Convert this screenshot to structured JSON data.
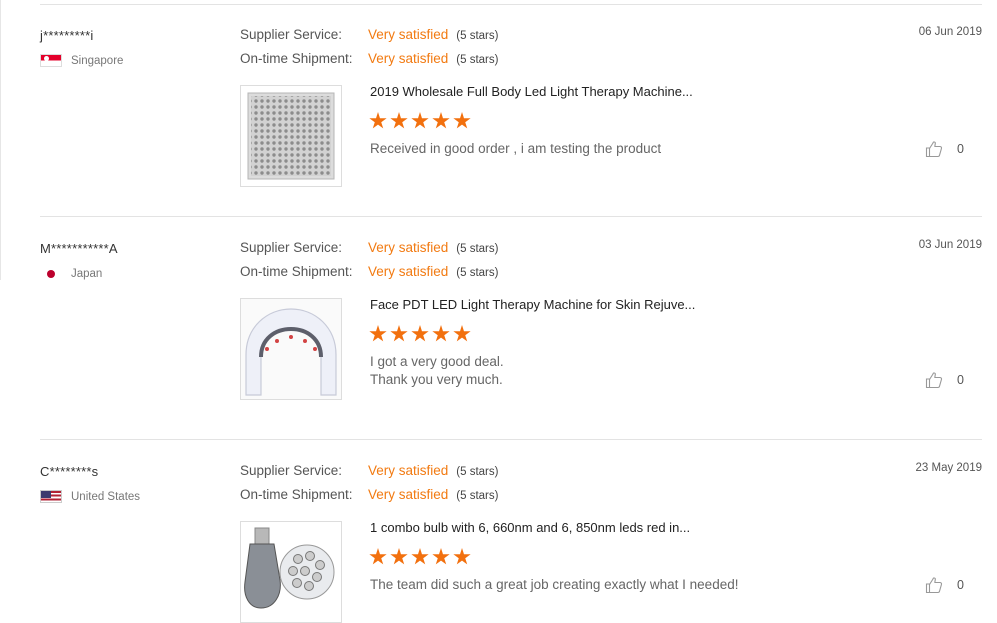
{
  "reviews": [
    {
      "buyer": "j*********i",
      "country": "Singapore",
      "flag_icon": "singapore-flag-icon",
      "date": "06 Jun 2019",
      "supplier_service_label": "Supplier Service:",
      "supplier_service_value": "Very satisfied",
      "supplier_service_stars": "(5 stars)",
      "shipment_label": "On-time Shipment:",
      "shipment_value": "Very satisfied",
      "shipment_stars": "(5 stars)",
      "product_title": "2019 Wholesale Full Body Led Light Therapy Machine...",
      "product_rating": 5,
      "comment_lines": [
        "Received in good order , i am testing the product"
      ],
      "likes": "0"
    },
    {
      "buyer": "M***********A",
      "country": "Japan",
      "flag_icon": "japan-flag-icon",
      "date": "03 Jun 2019",
      "supplier_service_label": "Supplier Service:",
      "supplier_service_value": "Very satisfied",
      "supplier_service_stars": "(5 stars)",
      "shipment_label": "On-time Shipment:",
      "shipment_value": "Very satisfied",
      "shipment_stars": "(5 stars)",
      "product_title": "Face PDT LED Light Therapy Machine for Skin Rejuve...",
      "product_rating": 5,
      "comment_lines": [
        "I got a very good deal.",
        "Thank you very much."
      ],
      "likes": "0"
    },
    {
      "buyer": "C********s",
      "country": "United States",
      "flag_icon": "us-flag-icon",
      "date": "23 May 2019",
      "supplier_service_label": "Supplier Service:",
      "supplier_service_value": "Very satisfied",
      "supplier_service_stars": "(5 stars)",
      "shipment_label": "On-time Shipment:",
      "shipment_value": "Very satisfied",
      "shipment_stars": "(5 stars)",
      "product_title": "1 combo bulb with 6, 660nm and 6, 850nm leds red in...",
      "product_rating": 5,
      "comment_lines": [
        "The team did such a great job creating exactly what I needed!"
      ],
      "likes": "0"
    }
  ],
  "colors": {
    "accent": "#f27a11",
    "star": "#f2700e",
    "separator": "#e3e3e3"
  },
  "icons": {
    "like": "thumbs-up-icon"
  }
}
